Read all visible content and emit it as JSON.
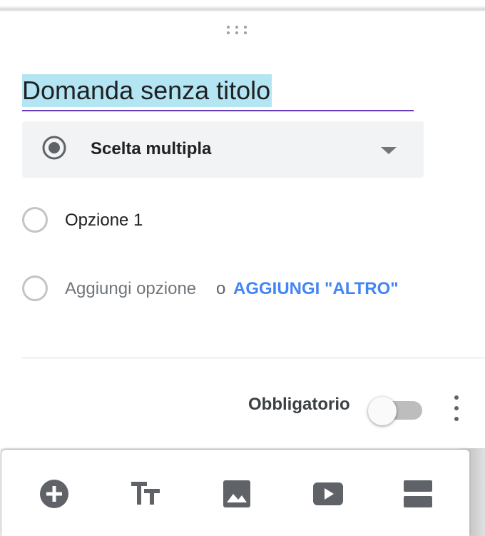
{
  "question": {
    "title": "Domanda senza titolo",
    "type_label": "Scelta multipla"
  },
  "options": [
    {
      "label": "Opzione 1"
    }
  ],
  "add_option": {
    "label": "Aggiungi opzione",
    "or_text": "o",
    "add_other_label": "AGGIUNGI \"ALTRO\""
  },
  "footer": {
    "required_label": "Obbligatorio",
    "required_on": false
  },
  "toolbar": {
    "items": [
      "add-question-icon",
      "add-title-icon",
      "add-image-icon",
      "add-video-icon",
      "add-section-icon"
    ]
  },
  "colors": {
    "accent": "#673ab7",
    "link": "#4285f4",
    "selection": "#b3e5f3"
  }
}
